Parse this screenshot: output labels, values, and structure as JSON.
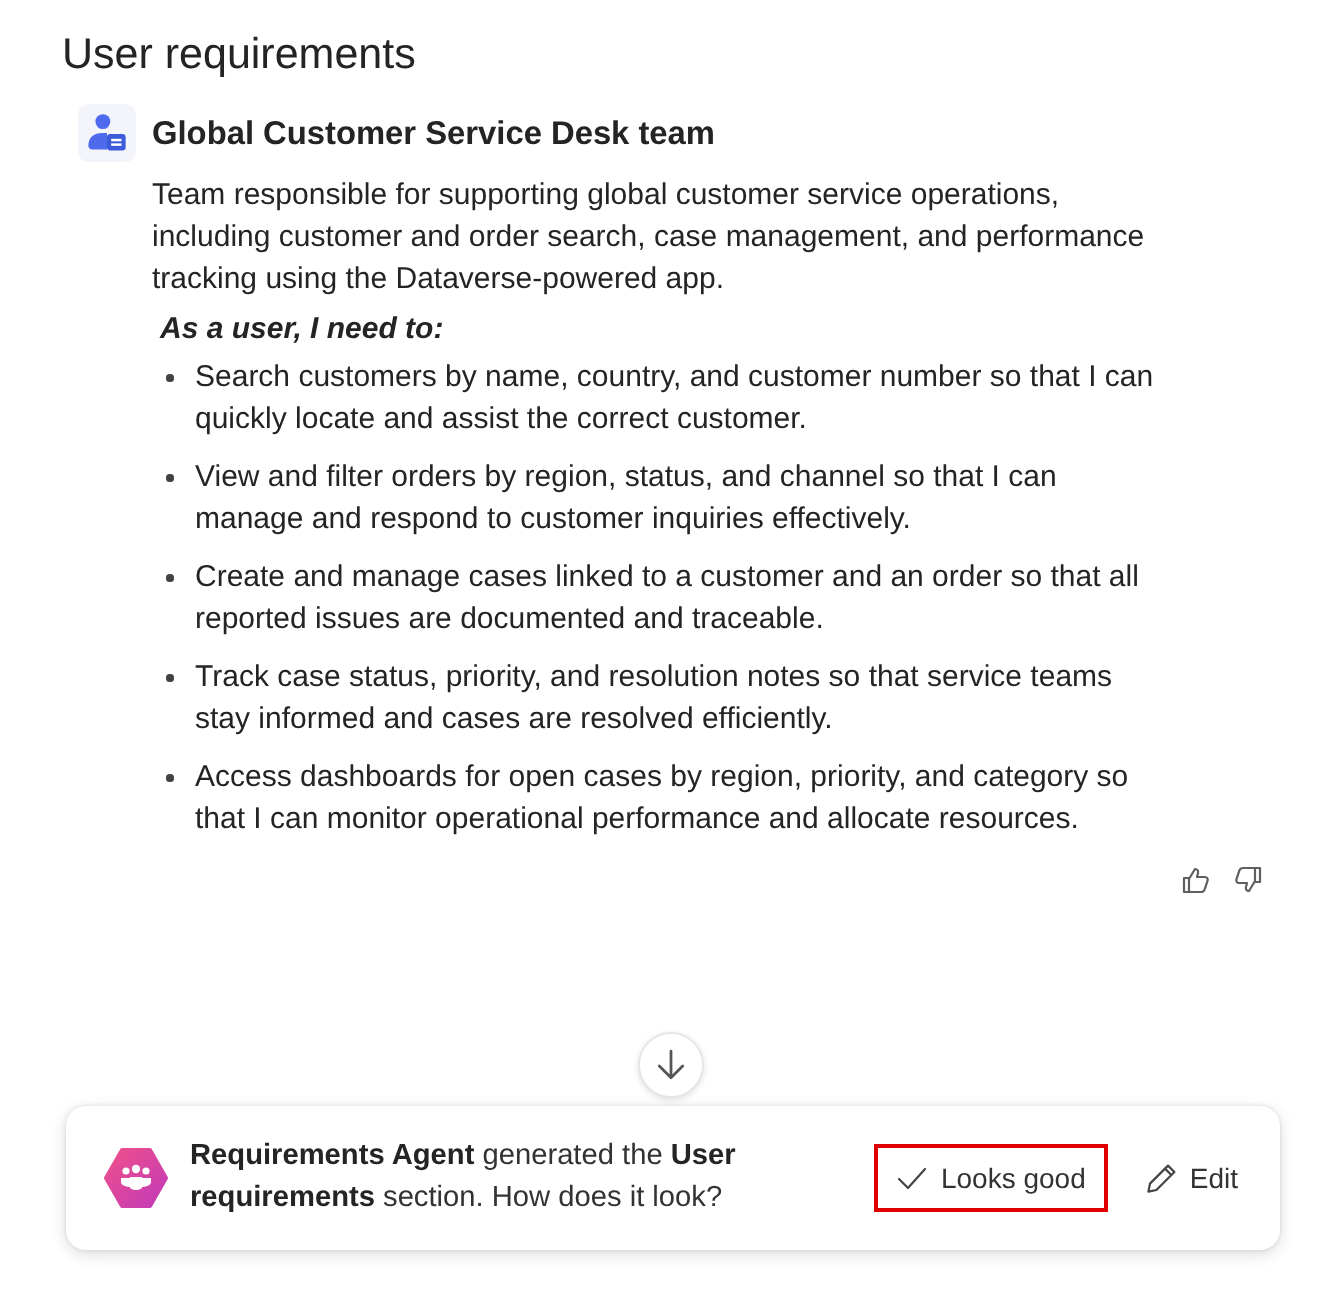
{
  "section": {
    "title": "User requirements"
  },
  "persona": {
    "name": "Global Customer Service Desk team",
    "description": "Team responsible for supporting global customer service operations, including customer and order search, case management, and performance tracking using the Dataverse-powered app.",
    "needs_heading": "As a user, I need to:",
    "needs": [
      "Search customers by name, country, and customer number so that I can quickly locate and assist the correct customer.",
      "View and filter orders by region, status, and channel so that I can manage and respond to customer inquiries effectively.",
      "Create and manage cases linked to a customer and an order so that all reported issues are documented and traceable.",
      "Track case status, priority, and resolution notes so that service teams stay informed and cases are resolved efficiently.",
      "Access dashboards for open cases by region, priority, and category so that I can monitor operational performance and allocate resources."
    ]
  },
  "agent_card": {
    "message": "**Requirements Agent** generated the **User requirements** section. How does it look?",
    "buttons": [
      {
        "label": "Looks good",
        "kind": "approve",
        "highlighted": true
      },
      {
        "label": "Edit",
        "kind": "edit",
        "highlighted": false
      }
    ]
  }
}
